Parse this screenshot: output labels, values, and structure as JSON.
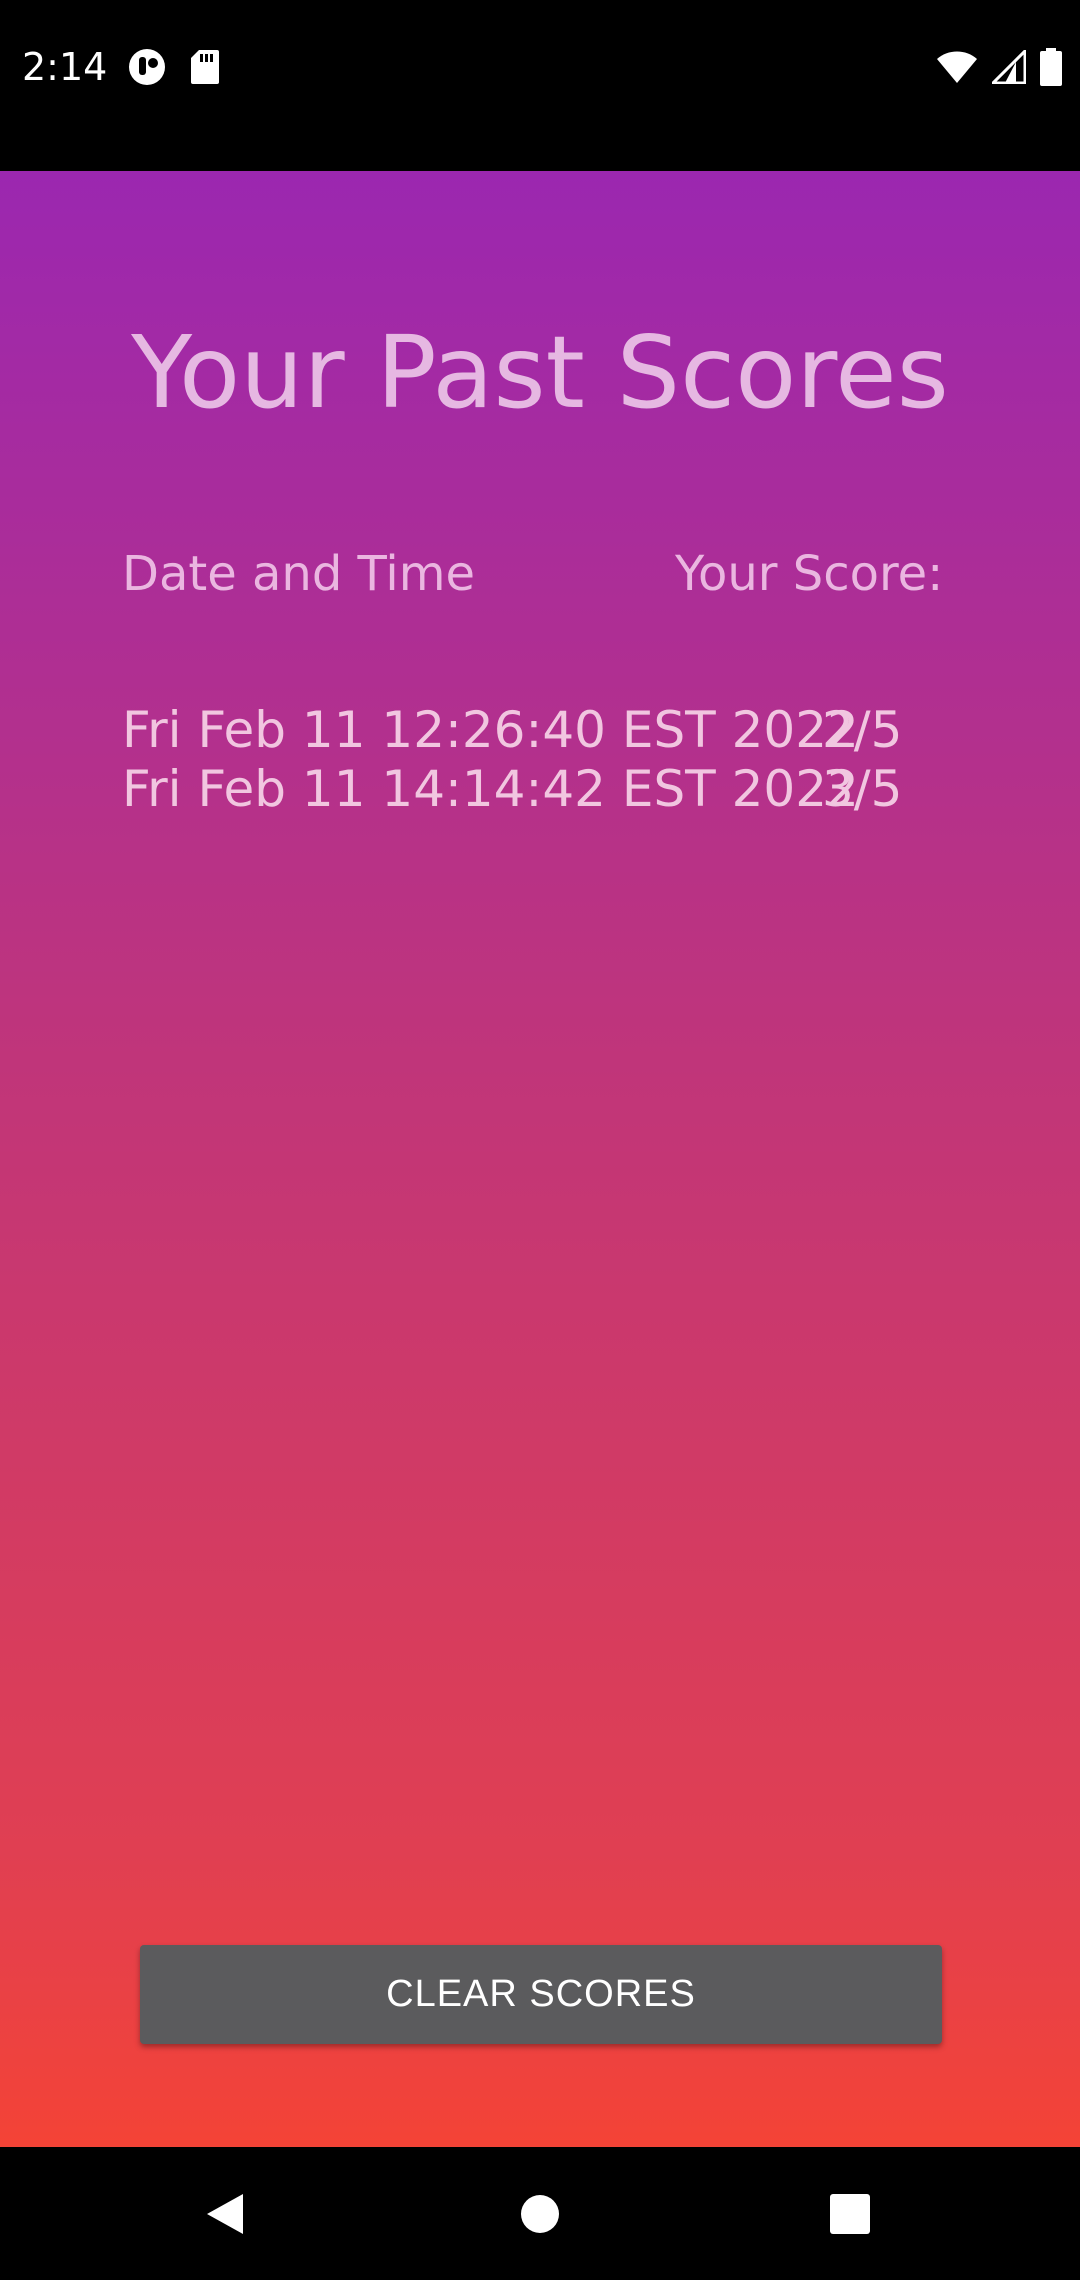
{
  "status_bar": {
    "time": "2:14",
    "left_icons": [
      "notification-app-icon",
      "sd-card-icon"
    ],
    "right_icons": [
      "wifi-icon",
      "cellular-signal-icon",
      "battery-icon"
    ]
  },
  "page": {
    "title": "Your Past Scores",
    "headers": {
      "date": "Date and Time",
      "score": "Your Score:"
    },
    "scores": [
      {
        "date": "Fri Feb 11 12:26:40 EST 2022",
        "score": "2/5"
      },
      {
        "date": "Fri Feb 11 14:14:42 EST 2022",
        "score": "3/5"
      }
    ],
    "clear_button_label": "CLEAR SCORES"
  },
  "colors": {
    "gradient_top": "#9b27b0",
    "gradient_bottom": "#f44336",
    "button_bg": "#5b5b5d"
  },
  "nav_bar": {
    "buttons": [
      "back-icon",
      "home-icon",
      "recents-icon"
    ]
  }
}
